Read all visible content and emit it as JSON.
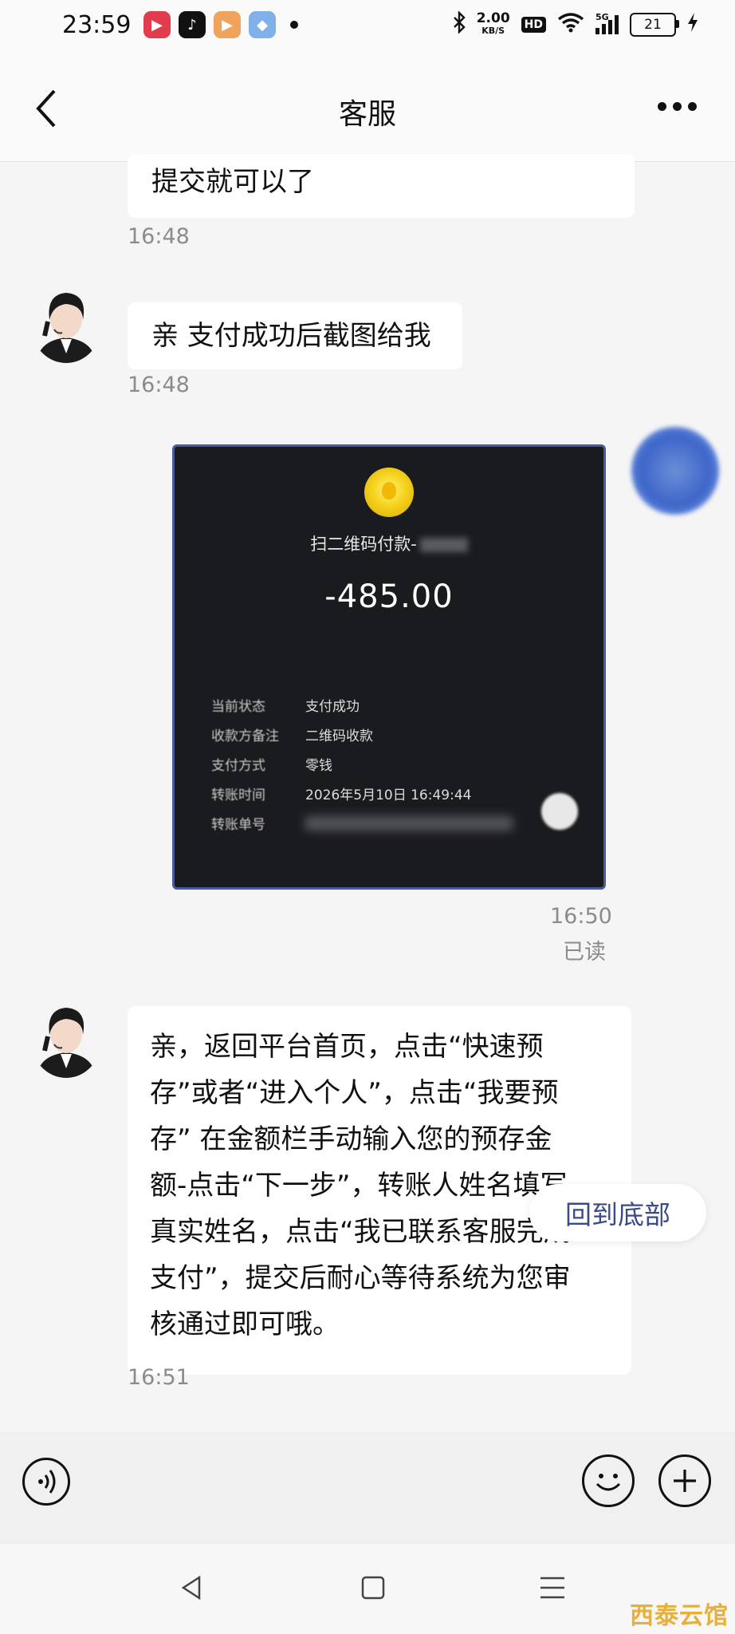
{
  "status_bar": {
    "time": "23:59",
    "net_speed_value": "2.00",
    "net_speed_unit": "KB/S",
    "hd": "HD",
    "signal": "5G",
    "battery": "21"
  },
  "header": {
    "title": "客服"
  },
  "messages": [
    {
      "text": "提交就可以了",
      "time": "16:48"
    },
    {
      "text": "亲 支付成功后截图给我",
      "time": "16:48"
    },
    {
      "time": "16:50",
      "status": "已读"
    },
    {
      "lines": [
        "亲，返回平台首页，点击“快速预",
        "存”或者“进入个人”，点击“我要预",
        "存” 在金额栏手动输入您的预存金",
        "额-点击“下一步”，转账人姓名填写",
        "真实姓名，点击“我已联系客服完成",
        "支付”，提交后耐心等待系统为您审",
        "核通过即可哦。"
      ],
      "time": "16:51"
    }
  ],
  "receipt": {
    "title": "扫二维码付款-",
    "amount": "-485.00",
    "rows": [
      {
        "label": "当前状态",
        "value": "支付成功"
      },
      {
        "label": "收款方备注",
        "value": "二维码收款"
      },
      {
        "label": "支付方式",
        "value": "零钱"
      },
      {
        "label": "转账时间",
        "value": "2026年5月10日 16:49:44"
      },
      {
        "label": "转账单号",
        "value": ""
      }
    ]
  },
  "back_to_bottom": "回到底部",
  "watermark": "西泰云馆"
}
